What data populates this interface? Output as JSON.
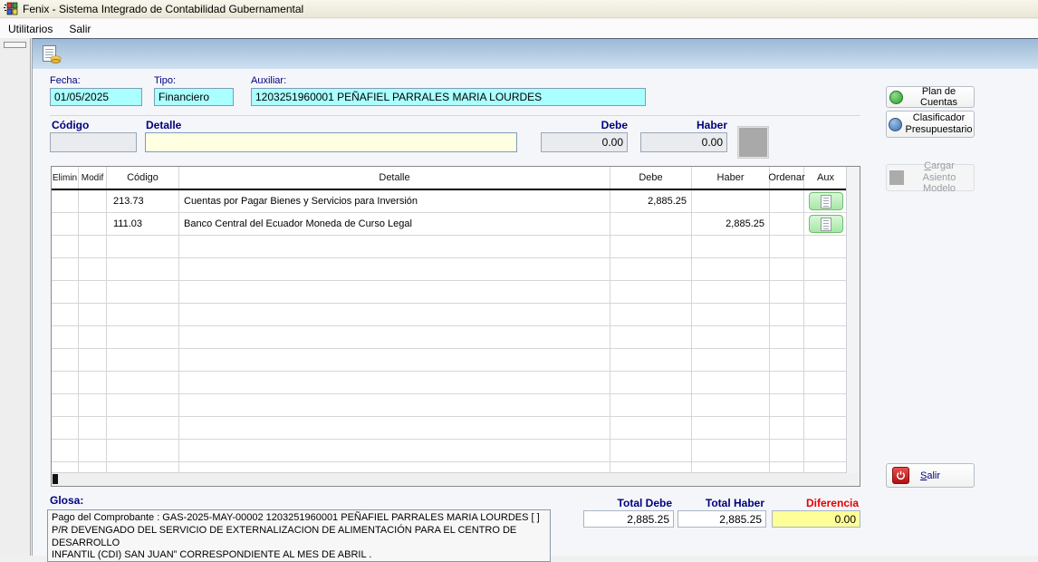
{
  "window": {
    "title": "Fenix - Sistema Integrado de Contabilidad Gubernamental"
  },
  "menu_bar": {
    "items": [
      {
        "label": "Utilitarios"
      },
      {
        "label": "Salir"
      }
    ]
  },
  "header_form": {
    "fecha_label": "Fecha:",
    "fecha_value": "01/05/2025",
    "tipo_label": "Tipo:",
    "tipo_value": "Financiero",
    "auxiliar_label": "Auxiliar:",
    "auxiliar_value": "1203251960001  PEÑAFIEL PARRALES MARIA LOURDES"
  },
  "entry_form": {
    "codigo_label": "Código",
    "codigo_value": "",
    "detalle_label": "Detalle",
    "detalle_value": "",
    "debe_label": "Debe",
    "debe_value": "0.00",
    "haber_label": "Haber",
    "haber_value": "0.00"
  },
  "grid": {
    "columns": [
      "Elimin",
      "Modif",
      "Código",
      "Detalle",
      "Debe",
      "Haber",
      "Ordenar",
      "Aux"
    ],
    "rows": [
      {
        "elimin": "",
        "modif": "",
        "codigo": "213.73",
        "detalle": "Cuentas por Pagar Bienes y Servicios para Inversión",
        "debe": "2,885.25",
        "haber": "",
        "ordenar": "",
        "aux_icon": "document-icon"
      },
      {
        "elimin": "",
        "modif": "",
        "codigo": "111.03",
        "detalle": "Banco Central del Ecuador Moneda de Curso Legal",
        "debe": "",
        "haber": "2,885.25",
        "ordenar": "",
        "aux_icon": "document-icon"
      }
    ]
  },
  "side_panel": {
    "plan_de_cuentas_label": "Plan de Cuentas",
    "clasificador_line1": "Clasificador",
    "clasificador_line2": "Presupuestario",
    "cargar_line1": "Cargar Asiento",
    "cargar_line2": "Modelo",
    "salir_label": "Salir"
  },
  "footer": {
    "glosa_label": "Glosa:",
    "glosa_text": "Pago del Comprobante : GAS-2025-MAY-00002  1203251960001 PEÑAFIEL PARRALES MARIA LOURDES   [ ]\nP/R DEVENGADO DEL SERVICIO DE EXTERNALIZACION DE ALIMENTACIÓN PARA EL CENTRO DE DESARROLLO\nINFANTIL (CDI) SAN JUAN” CORRESPONDIENTE AL MES DE ABRIL .",
    "total_debe_label": "Total Debe",
    "total_debe_value": "2,885.25",
    "total_haber_label": "Total Haber",
    "total_haber_value": "2,885.25",
    "diferencia_label": "Diferencia",
    "diferencia_value": "0.00"
  },
  "colors": {
    "field_cyan": "#AAFFFF",
    "field_ivory": "#FFFFE1",
    "diferencia_yellow": "#FFFF99",
    "label_navy": "#00007D",
    "diferencia_red": "#E30000",
    "aux_green": "#A6E8A6",
    "toolbar_blue_top": "#9DB9D6",
    "toolbar_blue_bottom": "#CDE0F0"
  }
}
